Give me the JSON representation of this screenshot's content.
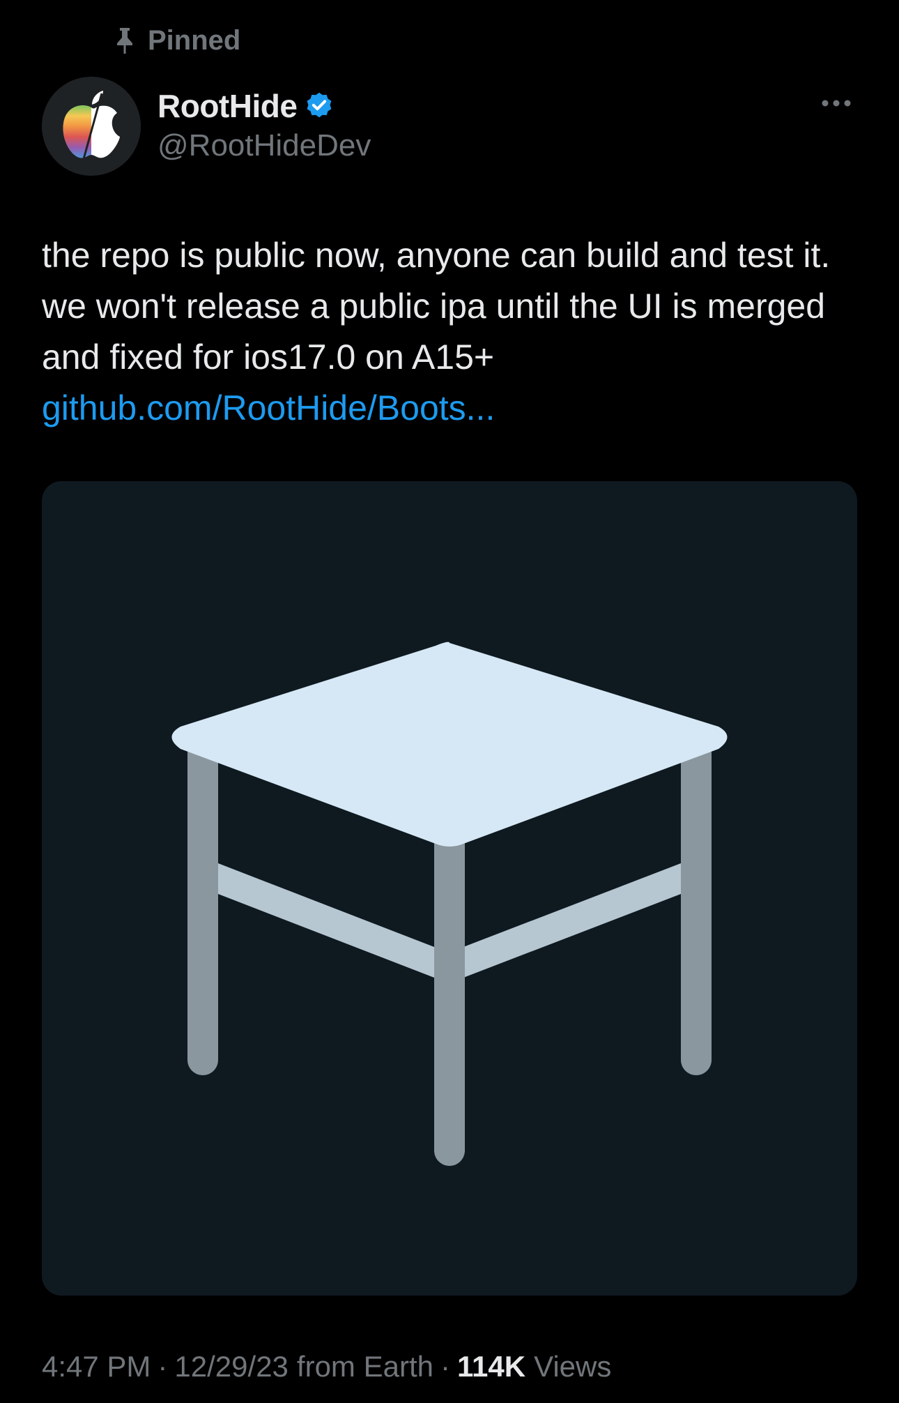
{
  "pinned": {
    "label": "Pinned",
    "icon": "pin-icon"
  },
  "author": {
    "name": "RootHide",
    "handle": "@RootHideDev",
    "verified_icon": "verified-badge-icon",
    "verified_color": "#1d9bf0"
  },
  "more_icon": "more-horizontal-icon",
  "tweet": {
    "text": "the repo is public now, anyone can build and test it. we won't release a public ipa until the UI is merged and fixed for ios17.0 on A15+",
    "link": "github.com/RootHide/Boots...",
    "media_icon": "table-emoji-icon"
  },
  "meta": {
    "time": "4:47 PM",
    "separator": "·",
    "date": "12/29/23",
    "source": "from Earth",
    "views_count": "114K",
    "views_label": "Views"
  },
  "colors": {
    "background": "#000000",
    "text": "#e7e9ea",
    "secondary_text": "#71767b",
    "link": "#1d9bf0",
    "media_background": "#0f1920"
  }
}
